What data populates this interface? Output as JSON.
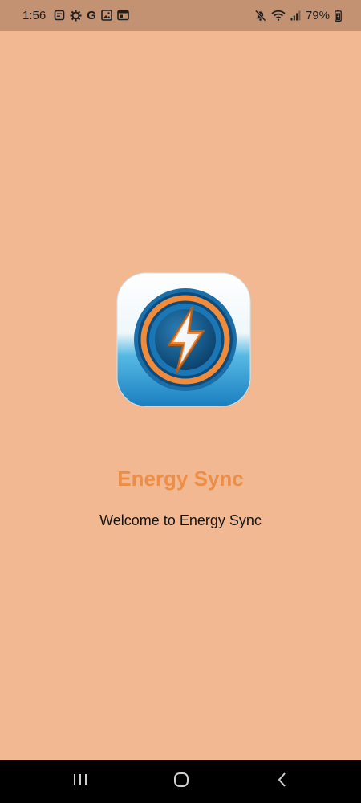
{
  "status_bar": {
    "time": "1:56",
    "battery": "79%",
    "left_icons": [
      "document-icon",
      "gear-icon",
      "google-icon",
      "image-icon",
      "calendar-icon"
    ],
    "right_icons": [
      "mute-icon",
      "wifi-icon",
      "signal-icon",
      "battery-icon"
    ],
    "google_letter": "G"
  },
  "app": {
    "title": "Energy Sync",
    "welcome": "Welcome to Energy Sync",
    "colors": {
      "background": "#f2b892",
      "title": "#ed8e47",
      "icon_blue": "#1f8fc9",
      "icon_orange": "#f08b3c"
    }
  },
  "nav_bar": {
    "buttons": [
      "recents-icon",
      "home-icon",
      "back-icon"
    ]
  }
}
